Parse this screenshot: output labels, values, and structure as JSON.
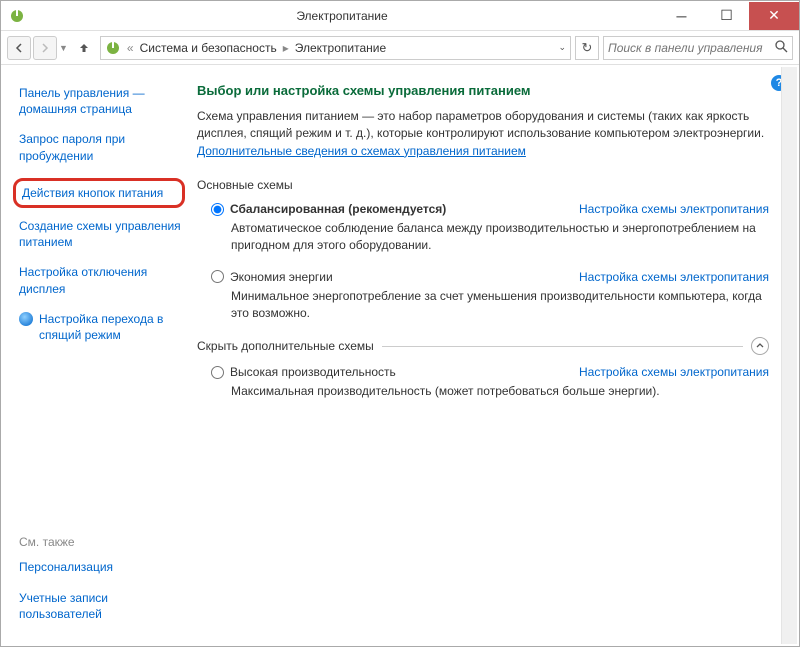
{
  "window": {
    "title": "Электропитание"
  },
  "breadcrumb": {
    "item1": "Система и безопасность",
    "item2": "Электропитание"
  },
  "search": {
    "placeholder": "Поиск в панели управления"
  },
  "sidebar": {
    "home": "Панель управления — домашняя страница",
    "items": [
      "Запрос пароля при пробуждении",
      "Действия кнопок питания",
      "Создание схемы управления питанием",
      "Настройка отключения дисплея",
      "Настройка перехода в спящий режим"
    ],
    "see_also_title": "См. также",
    "see_also": [
      "Персонализация",
      "Учетные записи пользователей"
    ]
  },
  "main": {
    "heading": "Выбор или настройка схемы управления питанием",
    "intro_text": "Схема управления питанием — это набор параметров оборудования и системы (таких как яркость дисплея, спящий режим и т. д.), которые контролируют использование компьютером электроэнергии. ",
    "intro_link": "Дополнительные сведения о схемах управления питанием",
    "section_basic": "Основные схемы",
    "plans": [
      {
        "name": "Сбалансированная (рекомендуется)",
        "desc": "Автоматическое соблюдение баланса между производительностью и энергопотреблением на пригодном для этого оборудовании.",
        "link": "Настройка схемы электропитания",
        "selected": true,
        "bold": true
      },
      {
        "name": "Экономия энергии",
        "desc": "Минимальное энергопотребление за счет уменьшения производительности компьютера, когда это возможно.",
        "link": "Настройка схемы электропитания",
        "selected": false,
        "bold": false
      }
    ],
    "section_extra": "Скрыть дополнительные схемы",
    "extra_plan": {
      "name": "Высокая производительность",
      "desc": "Максимальная производительность (может потребоваться больше энергии).",
      "link": "Настройка схемы электропитания"
    }
  }
}
